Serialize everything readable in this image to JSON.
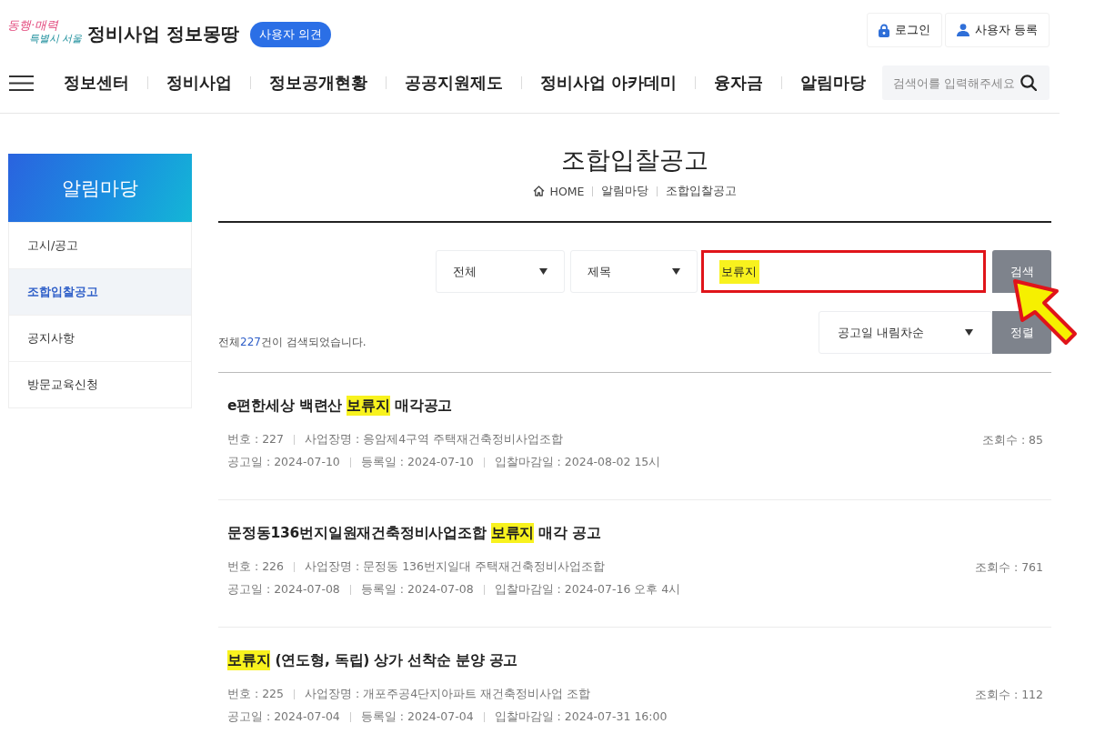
{
  "header": {
    "logo": {
      "line1": "동행·매력",
      "line2": "특별시 서울"
    },
    "site_title": "정비사업 정보몽땅",
    "feedback_badge": "사용자 의견",
    "account_links": [
      {
        "kind": "login",
        "label": "로그인"
      },
      {
        "kind": "register",
        "label": "사용자 등록"
      }
    ]
  },
  "nav": {
    "items": [
      "정보센터",
      "정비사업",
      "정보공개현황",
      "공공지원제도",
      "정비사업 아카데미",
      "융자금",
      "알림마당"
    ],
    "search": {
      "placeholder": "검색어를 입력해주세요"
    }
  },
  "sidebar": {
    "title": "알림마당",
    "items": [
      {
        "label": "고시/공고",
        "selected": false
      },
      {
        "label": "조합입찰공고",
        "selected": true
      },
      {
        "label": "공지사항",
        "selected": false
      },
      {
        "label": "방문교육신청",
        "selected": false
      }
    ]
  },
  "page": {
    "title": "조합입찰공고",
    "breadcrumb": [
      "HOME",
      "알림마당",
      "조합입찰공고"
    ]
  },
  "search": {
    "scope": "전체",
    "field": "제목",
    "value": "보류지",
    "value_highlighted": true,
    "outlined": true,
    "button": "검색",
    "pointer_arrow": true
  },
  "results": {
    "summary": [
      {
        "text": "전체",
        "emphasis": false
      },
      {
        "text": "227",
        "emphasis": true
      },
      {
        "text": "건이 검색되었습니다.",
        "emphasis": false
      }
    ],
    "sort": {
      "value": "공고일 내림차순",
      "button": "정렬"
    }
  },
  "posts": [
    {
      "title": [
        {
          "text": "e편한세상 백련산 ",
          "highlighted": false
        },
        {
          "text": "보류지",
          "highlighted": true
        },
        {
          "text": " 매각공고",
          "highlighted": false
        }
      ],
      "meta": [
        [
          "번호 : 227",
          "사업장명 : 응암제4구역 주택재건축정비사업조합"
        ],
        [
          "공고일 : 2024-07-10",
          "등록일 : 2024-07-10",
          "입찰마감일 : 2024-08-02 15시"
        ]
      ],
      "views": "조회수 : 85"
    },
    {
      "title": [
        {
          "text": "문정동136번지일원재건축정비사업조합 ",
          "highlighted": false
        },
        {
          "text": "보류지",
          "highlighted": true
        },
        {
          "text": " 매각 공고",
          "highlighted": false
        }
      ],
      "meta": [
        [
          "번호 : 226",
          "사업장명 : 문정동 136번지일대 주택재건축정비사업조합"
        ],
        [
          "공고일 : 2024-07-08",
          "등록일 : 2024-07-08",
          "입찰마감일 : 2024-07-16 오후 4시"
        ]
      ],
      "views": "조회수 : 761"
    },
    {
      "title": [
        {
          "text": "보류지",
          "highlighted": true
        },
        {
          "text": " (연도형, 독립) 상가 선착순 분양 공고",
          "highlighted": false
        }
      ],
      "meta": [
        [
          "번호 : 225",
          "사업장명 : 개포주공4단지아파트 재건축정비사업 조합"
        ],
        [
          "공고일 : 2024-07-04",
          "등록일 : 2024-07-04",
          "입찰마감일 : 2024-07-31 16:00"
        ]
      ],
      "views": "조회수 : 112"
    }
  ]
}
